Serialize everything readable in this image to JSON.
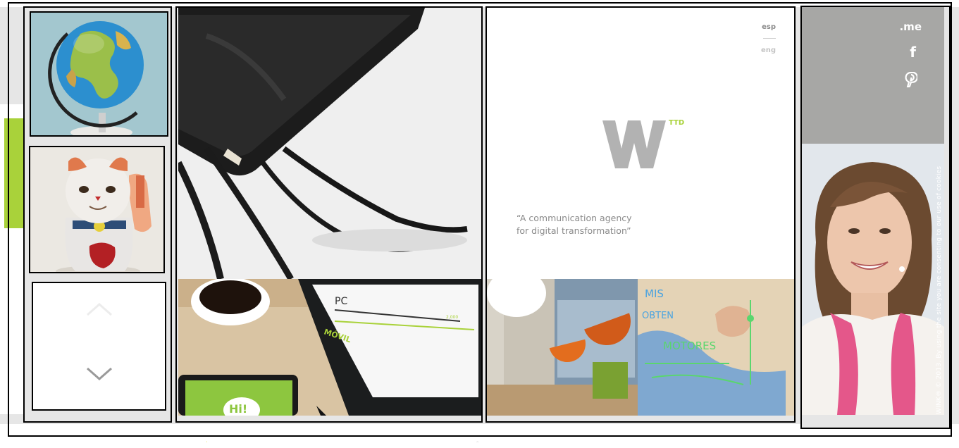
{
  "language": {
    "options": [
      "esp",
      "eng"
    ]
  },
  "brand": {
    "logo_letter": "W",
    "logo_superscript": "TTD",
    "tagline_line1": "“A communication agency",
    "tagline_line2": "for digital transformation”"
  },
  "social": {
    "me": ".me",
    "facebook": "f"
  },
  "footer": {
    "cookie_notice": "WINK® © 2013. By using the site you are consenting to our use of cookies"
  },
  "tablet_screen": {
    "pc_label": "PC",
    "movil_label": "MÓVIL",
    "value_label": "2,000",
    "hi_label": "Hi!"
  },
  "whiteboard": {
    "words": [
      "MIS",
      "OBTEN",
      "MOTORES"
    ]
  },
  "icons": [
    "chevron-up-icon",
    "chevron-down-icon",
    "facebook-icon",
    "pinterest-icon"
  ],
  "colors": {
    "accent": "#a9d23a",
    "logo_grey": "#b2b2b2",
    "social_panel": "#a7a7a5",
    "page_grey": "#e6e6e6"
  }
}
